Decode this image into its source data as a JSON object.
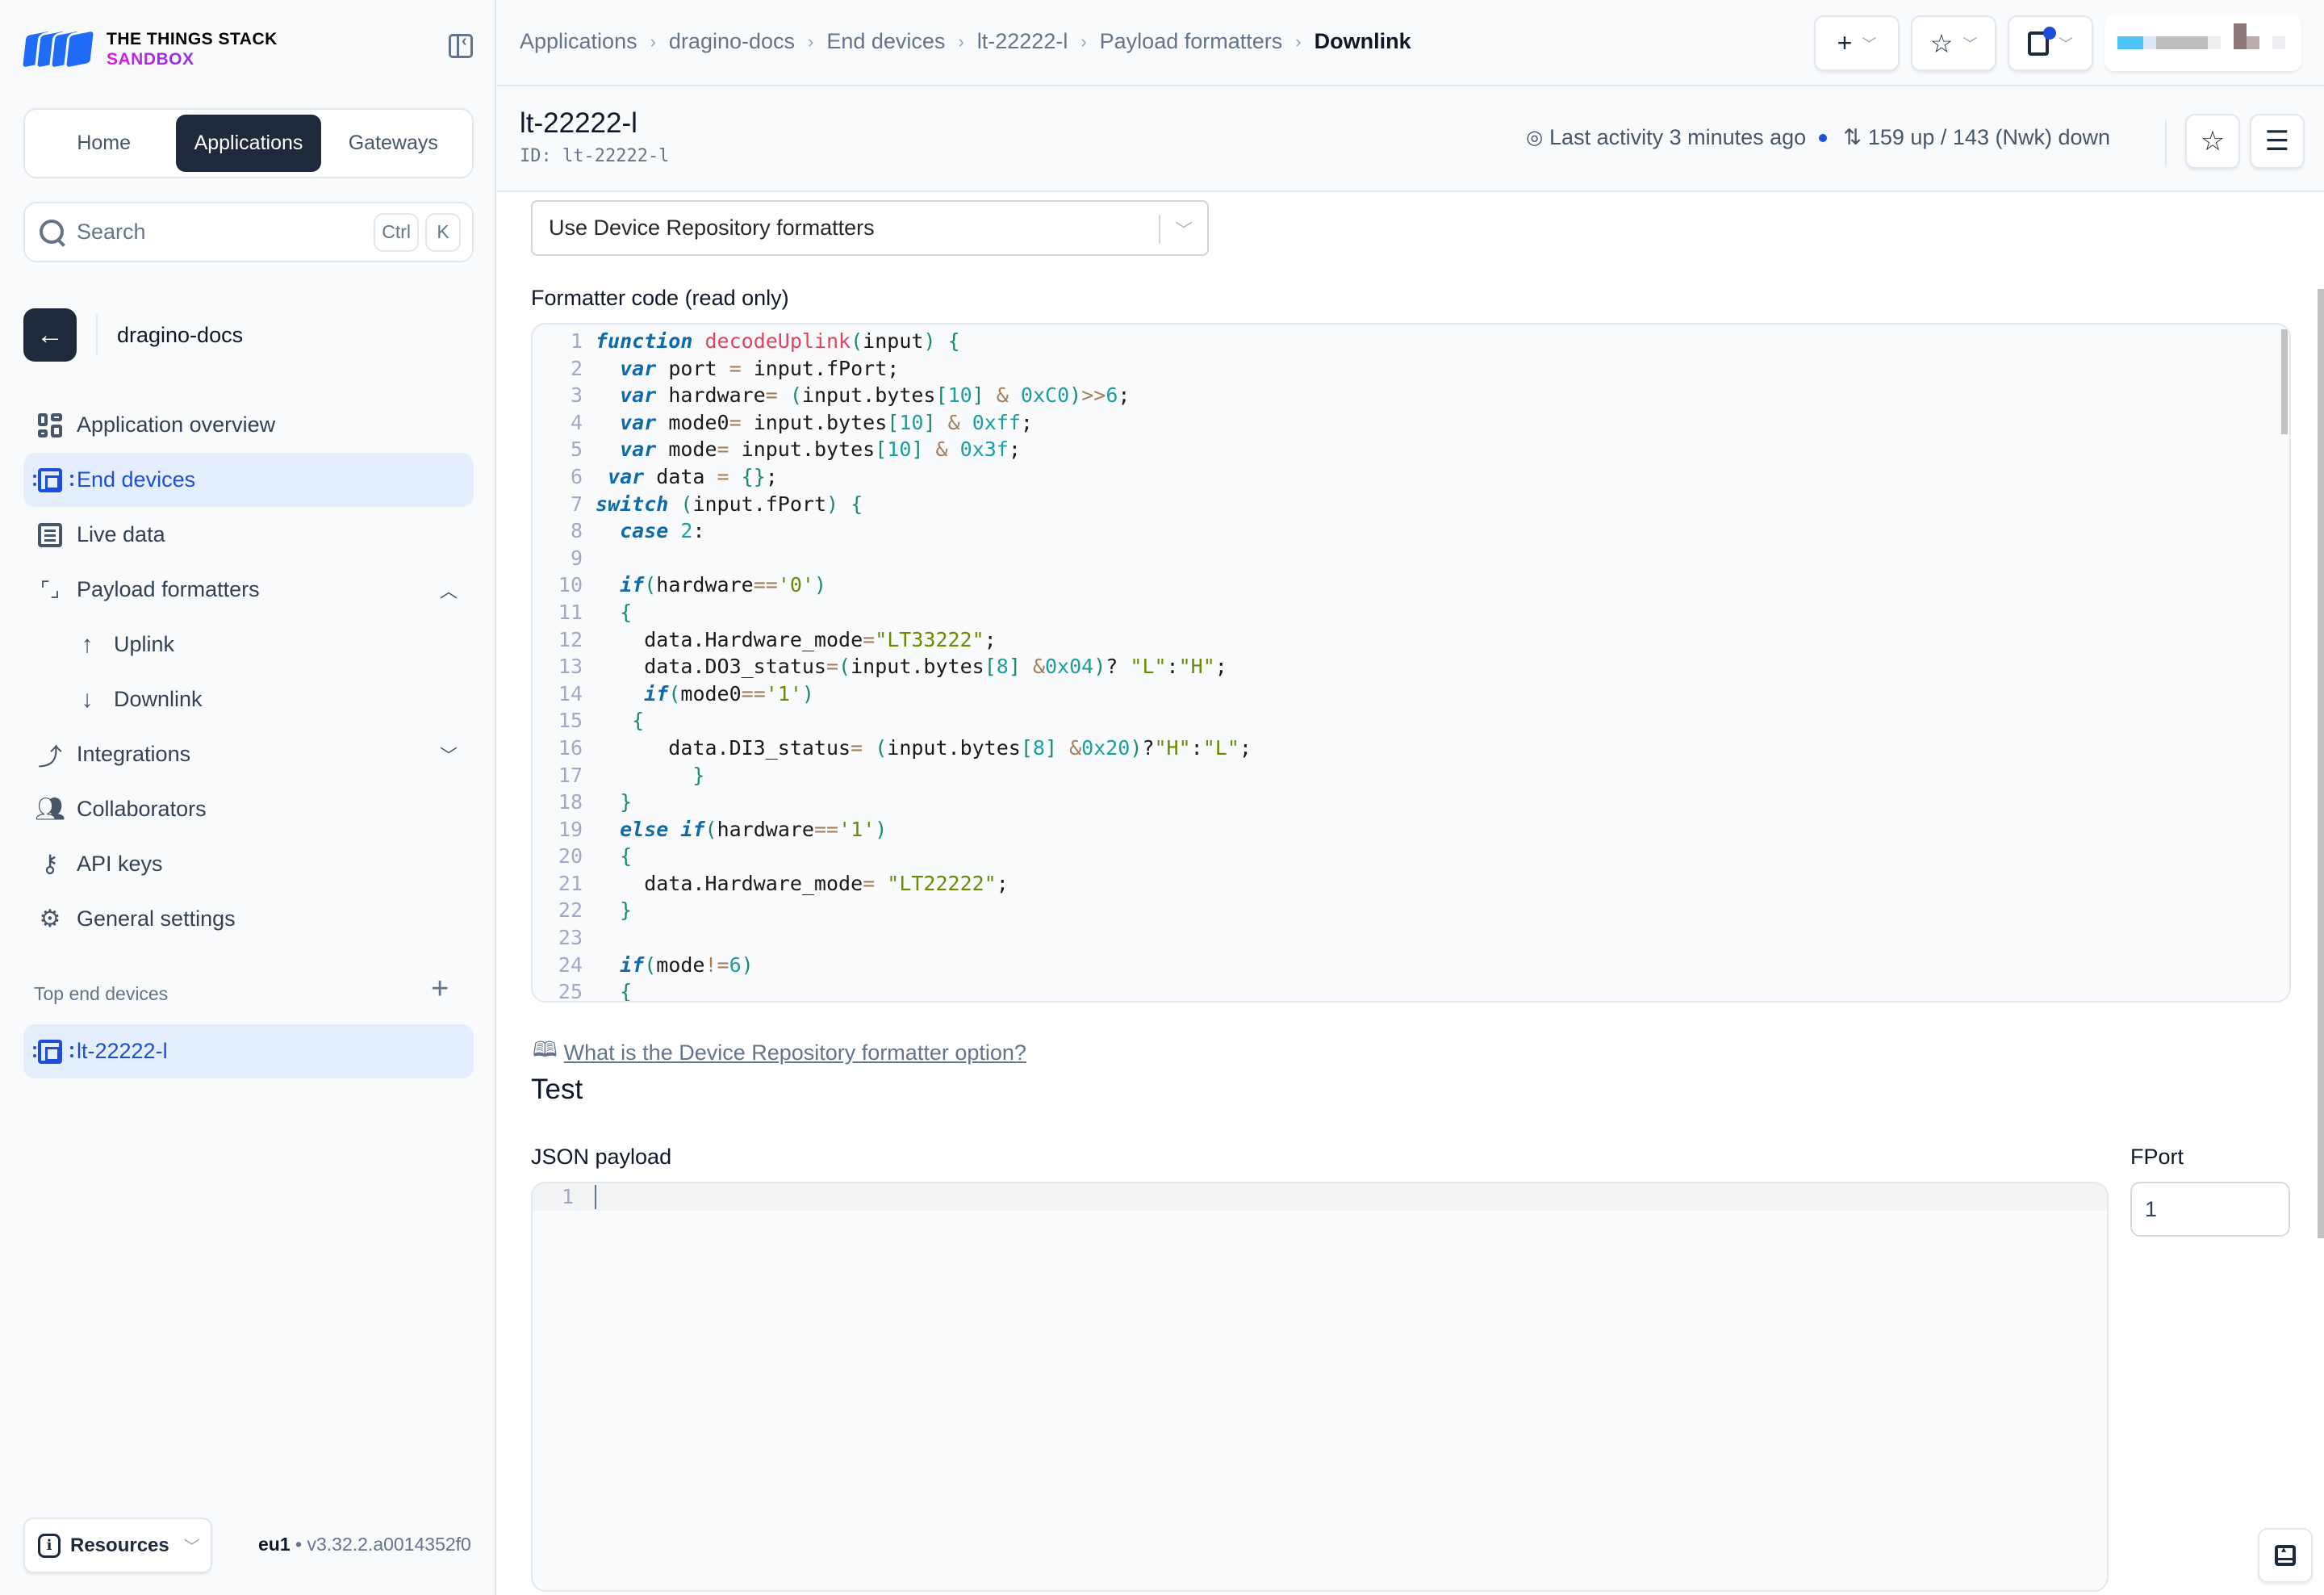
{
  "brand": {
    "line1": "THE THINGS STACK",
    "line2": "SANDBOX"
  },
  "mode_switch": [
    {
      "label": "Home",
      "active": false
    },
    {
      "label": "Applications",
      "active": true
    },
    {
      "label": "Gateways",
      "active": false
    }
  ],
  "search": {
    "placeholder": "Search",
    "shortcut": [
      "Ctrl",
      "K"
    ]
  },
  "application": {
    "name": "dragino-docs"
  },
  "sidebar": {
    "items": [
      {
        "label": "Application overview",
        "icon": "grid-icon",
        "active": false
      },
      {
        "label": "End devices",
        "icon": "chip-icon",
        "active": true
      },
      {
        "label": "Live data",
        "icon": "list-icon",
        "active": false
      },
      {
        "label": "Payload formatters",
        "icon": "code-frame-icon",
        "expanded": true
      },
      {
        "label": "Uplink",
        "icon": "arrow-up-icon",
        "sub": true
      },
      {
        "label": "Downlink",
        "icon": "arrow-down-icon",
        "sub": true
      },
      {
        "label": "Integrations",
        "icon": "integrations-icon",
        "expanded": false
      },
      {
        "label": "Collaborators",
        "icon": "users-icon"
      },
      {
        "label": "API keys",
        "icon": "key-icon"
      },
      {
        "label": "General settings",
        "icon": "gear-icon"
      }
    ],
    "top_devices_label": "Top end devices",
    "top_devices": [
      {
        "label": "lt-22222-l"
      }
    ],
    "resources_label": "Resources",
    "cluster": "eu1",
    "version": "v3.32.2.a0014352f0"
  },
  "breadcrumb": [
    "Applications",
    "dragino-docs",
    "End devices",
    "lt-22222-l",
    "Payload formatters",
    "Downlink"
  ],
  "page": {
    "title": "lt-22222-l",
    "id_label": "ID: lt-22222-l",
    "last_activity": "Last activity 3 minutes ago",
    "traffic": "159 up / 143 (Nwk) down"
  },
  "formatter": {
    "type_selected": "Use Device Repository formatters",
    "code_label": "Formatter code (read only)",
    "code_lines": [
      "function decodeUplink(input) {",
      "  var port = input.fPort;",
      "  var hardware= (input.bytes[10] & 0xC0)>>6;",
      "  var mode0= input.bytes[10] & 0xff;",
      "  var mode= input.bytes[10] & 0x3f;",
      " var data = {};",
      "switch (input.fPort) {",
      "  case 2:",
      "",
      "  if(hardware=='0')",
      "  {",
      "    data.Hardware_mode=\"LT33222\";",
      "    data.DO3_status=(input.bytes[8] &0x04)? \"L\":\"H\";",
      "    if(mode0=='1')",
      "   {",
      "      data.DI3_status= (input.bytes[8] &0x20)?\"H\":\"L\";",
      "        }",
      "  }",
      "  else if(hardware=='1')",
      "  {",
      "    data.Hardware_mode= \"LT22222\";",
      "  }",
      "",
      "  if(mode!=6)",
      "  {"
    ],
    "help_link": "What is the Device Repository formatter option?"
  },
  "test": {
    "title": "Test",
    "json_label": "JSON payload",
    "json_value": "",
    "fport_label": "FPort",
    "fport_value": "1"
  },
  "colors": {
    "accent": "#1d4ed8",
    "active_bg": "#e5eefc",
    "dark": "#1e293b"
  }
}
